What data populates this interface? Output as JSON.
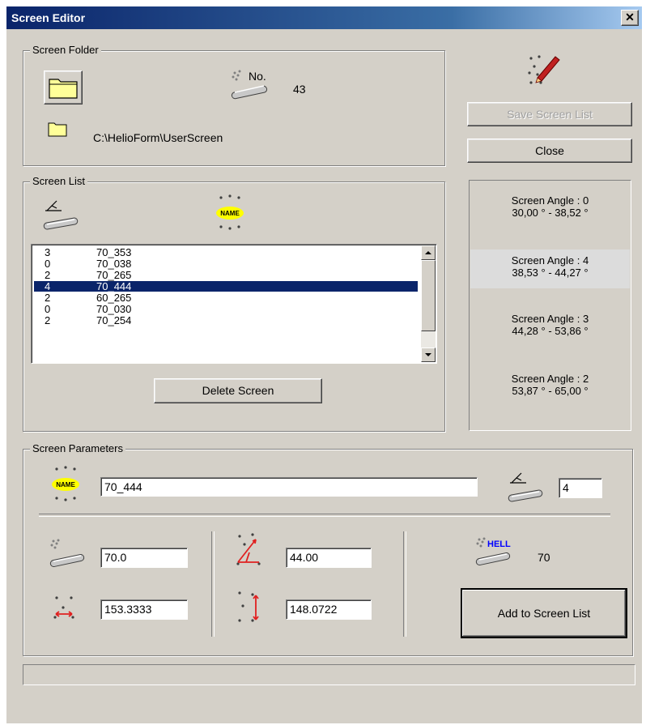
{
  "window": {
    "title": "Screen Editor",
    "close_glyph": "✕"
  },
  "folder": {
    "legend": "Screen Folder",
    "number": "43",
    "path": "C:\\HelioForm\\UserScreen",
    "no_label": "No."
  },
  "buttons": {
    "save": "Save Screen List",
    "close": "Close",
    "delete": "Delete Screen",
    "add": "Add to Screen List"
  },
  "screen_list": {
    "legend": "Screen List",
    "rows": [
      {
        "angle": "3",
        "name": "70_353"
      },
      {
        "angle": "0",
        "name": "70_038"
      },
      {
        "angle": "2",
        "name": "70_265"
      },
      {
        "angle": "4",
        "name": "70_444",
        "selected": true
      },
      {
        "angle": "2",
        "name": "60_265"
      },
      {
        "angle": "0",
        "name": "70_030"
      },
      {
        "angle": "2",
        "name": "70_254"
      }
    ]
  },
  "angles": [
    {
      "label": "Screen Angle : 0",
      "range": "30,00 ° - 38,52 °"
    },
    {
      "label": "Screen Angle : 4",
      "range": "38,53 ° - 44,27 °",
      "highlighted": true
    },
    {
      "label": "Screen Angle : 3",
      "range": "44,28 ° - 53,86 °"
    },
    {
      "label": "Screen Angle : 2",
      "range": "53,87 ° - 65,00 °"
    }
  ],
  "params": {
    "legend": "Screen Parameters",
    "name": "70_444",
    "angle": "4",
    "lpi": "70.0",
    "degree": "44.00",
    "hspacing": "153.3333",
    "vspacing": "148.0722",
    "hell_label": "HELL",
    "hell_value": "70",
    "name_badge": "NAME"
  },
  "colors": {
    "selection": "#0a246a",
    "folder_yellow": "#ffff99",
    "icon_red": "#e02020",
    "hell_blue": "#0000ff"
  }
}
